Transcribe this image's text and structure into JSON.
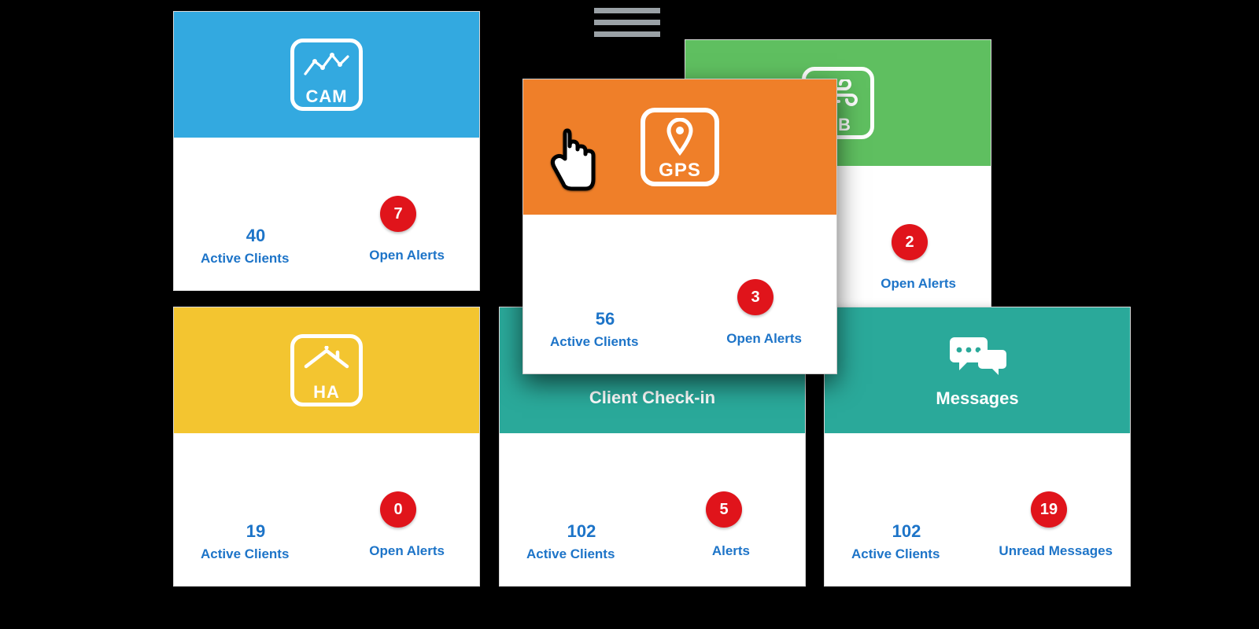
{
  "hamburger": {
    "name": "menu-icon"
  },
  "metric_label_default": "Active Clients",
  "cards": {
    "cam": {
      "code": "CAM",
      "icon": "chart-icon",
      "active_clients": 40,
      "badge": 7,
      "badge_label": "Open Alerts",
      "color": "#33a9e0"
    },
    "bb": {
      "code": "BB",
      "icon": "wind-icon",
      "active_clients": null,
      "badge": 2,
      "badge_label": "Open Alerts",
      "color": "#5fbf60"
    },
    "gps": {
      "code": "GPS",
      "icon": "pin-icon",
      "active_clients": 56,
      "badge": 3,
      "badge_label": "Open Alerts",
      "color": "#ef7f29",
      "highlighted": true
    },
    "ha": {
      "code": "HA",
      "icon": "house-icon",
      "active_clients": 19,
      "badge": 0,
      "badge_label": "Open Alerts",
      "color": "#f3c530"
    },
    "checkin": {
      "title": "Client Check-in",
      "icon": "user-check-icon",
      "active_clients": 102,
      "badge": 5,
      "badge_label": "Alerts",
      "color": "#2aa99a"
    },
    "messages": {
      "title": "Messages",
      "icon": "chat-icon",
      "active_clients": 102,
      "badge": 19,
      "badge_label": "Unread Messages",
      "color": "#2aa99a"
    }
  }
}
